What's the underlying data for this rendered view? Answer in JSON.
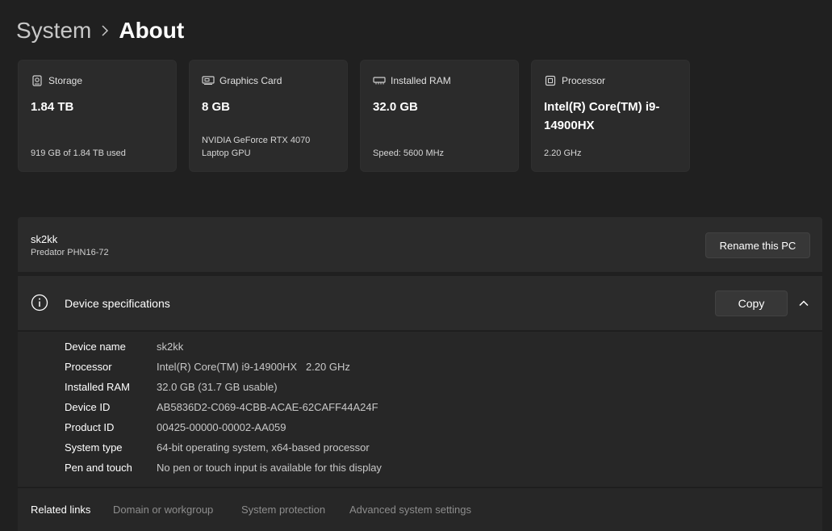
{
  "breadcrumb": {
    "parent": "System",
    "current": "About"
  },
  "cards": [
    {
      "icon": "storage-icon",
      "label": "Storage",
      "value": "1.84 TB",
      "sub": "919 GB of 1.84 TB used"
    },
    {
      "icon": "graphics-card-icon",
      "label": "Graphics Card",
      "value": "8 GB",
      "sub": "NVIDIA GeForce RTX 4070 Laptop GPU"
    },
    {
      "icon": "ram-icon",
      "label": "Installed RAM",
      "value": "32.0 GB",
      "sub": "Speed: 5600 MHz"
    },
    {
      "icon": "processor-icon",
      "label": "Processor",
      "value": "Intel(R) Core(TM) i9-14900HX",
      "sub": "2.20 GHz"
    }
  ],
  "pc": {
    "name": "sk2kk",
    "model": "Predator PHN16-72",
    "rename_label": "Rename this PC"
  },
  "specs": {
    "title": "Device specifications",
    "copy_label": "Copy",
    "rows": [
      {
        "key": "Device name",
        "value": "sk2kk"
      },
      {
        "key": "Processor",
        "value": "Intel(R) Core(TM) i9-14900HX   2.20 GHz"
      },
      {
        "key": "Installed RAM",
        "value": "32.0 GB (31.7 GB usable)"
      },
      {
        "key": "Device ID",
        "value": "AB5836D2-C069-4CBB-ACAE-62CAFF44A24F"
      },
      {
        "key": "Product ID",
        "value": "00425-00000-00002-AA059"
      },
      {
        "key": "System type",
        "value": "64-bit operating system, x64-based processor"
      },
      {
        "key": "Pen and touch",
        "value": "No pen or touch input is available for this display"
      }
    ]
  },
  "related": {
    "title": "Related links",
    "links": [
      "Domain or workgroup",
      "System protection",
      "Advanced system settings"
    ]
  },
  "colors": {
    "background": "#202020",
    "card": "#2b2b2b",
    "muted_link": "#8d8d8d"
  }
}
